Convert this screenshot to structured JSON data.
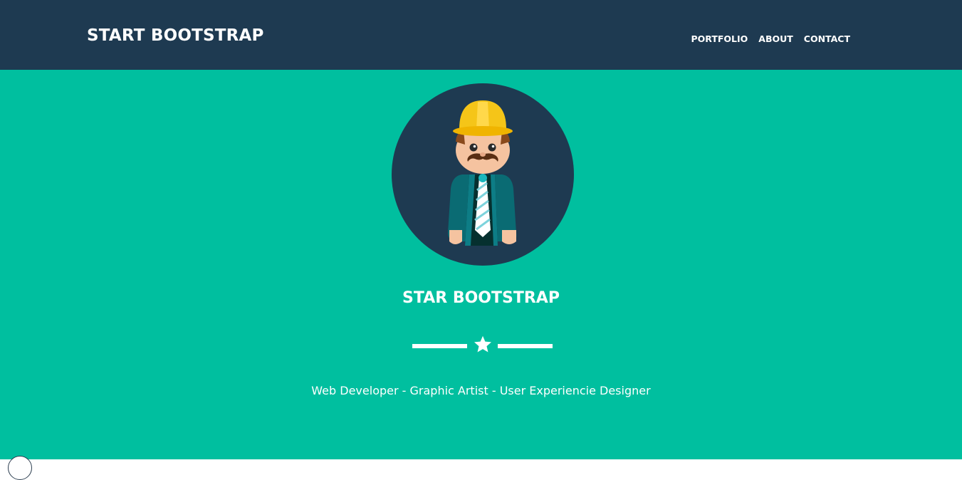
{
  "navbar": {
    "brand": "START BOOTSTRAP",
    "items": [
      {
        "label": "PORTFOLIO"
      },
      {
        "label": "ABOUT"
      },
      {
        "label": "CONTACT"
      }
    ]
  },
  "hero": {
    "title": "STAR BOOTSTRAP",
    "skills": "Web Developer - Graphic Artist - User Experiencie Designer",
    "divider_icon": "star-icon",
    "avatar_icon": "construction-worker-avatar"
  },
  "colors": {
    "navbar_bg": "#1e3a51",
    "hero_bg": "#00bf9f",
    "text": "#ffffff",
    "hard_hat": "#f5c518",
    "jacket": "#0a6b73"
  }
}
